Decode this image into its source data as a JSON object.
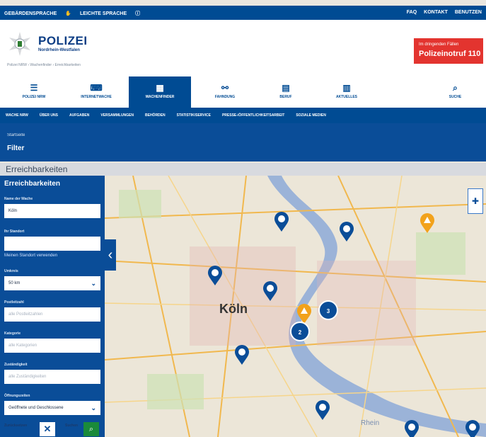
{
  "topbar": {
    "left_items": [
      "GEBÄRDENSPRACHE",
      "LEICHTE SPRACHE"
    ],
    "right_items": [
      "FAQ",
      "KONTAKT",
      "BENUTZEN"
    ]
  },
  "brand": {
    "name": "POLIZEI",
    "state": "Nordrhein-Westfalen"
  },
  "breadcrumb": "Polizei NRW › Wachenfinder › Erreichbarkeiten",
  "emergency": {
    "line1": "Im dringenden Fällen",
    "line2": "Polizeinotruf 110"
  },
  "mainnav": [
    {
      "label": "POLIZEI NRW",
      "icon": "list-icon"
    },
    {
      "label": "INTERNETWACHE",
      "icon": "keyboard-icon"
    },
    {
      "label": "WACHENFINDER",
      "icon": "building-icon"
    },
    {
      "label": "FAHNDUNG",
      "icon": "cuffs-icon"
    },
    {
      "label": "BERUF",
      "icon": "grid-icon"
    },
    {
      "label": "AKTUELLES",
      "icon": "news-icon"
    },
    {
      "label": "SUCHE",
      "icon": "search-icon"
    }
  ],
  "subnav": [
    "WACHE NRW",
    "ÜBER UNS",
    "AUFGABEN",
    "VERSAMMLUNGEN",
    "BEHÖRDEN",
    "STATISTIK/SERVICE",
    "PRESSE-/ÖFFENTLICHKEITSARBEIT",
    "SOZIALE MEDIEN"
  ],
  "pagehead": {
    "small": "Startseite",
    "big": "Filter"
  },
  "section_title": "Erreichbarkeiten",
  "sidebar": {
    "title": "Erreichbarkeiten",
    "name_label": "Name der Wache",
    "name_value": "Köln",
    "location_label": "Ihr Standort",
    "location_value": "",
    "use_location": "Meinen Standort verwenden",
    "radius_label": "Umkreis",
    "radius_value": "50 km",
    "postal_label": "Postleitzahl",
    "postal_placeholder": "alle Postleitzahlen",
    "category_label": "Kategorie",
    "category_placeholder": "alle Kategorien",
    "responsibility_label": "Zuständigkeit",
    "responsibility_placeholder": "alle Zuständigkeiten",
    "hours_label": "Öffnungszeiten",
    "hours_value": "Geöffnete und Geschlossene",
    "reset_label": "Zurücksetzen",
    "search_label": "Suchen"
  },
  "map": {
    "city": "Köln",
    "river": "Rhein",
    "clusters": [
      "3",
      "2"
    ]
  },
  "colors": {
    "primary": "#004b93",
    "emergency": "#e3342f",
    "marker_warning": "#f2a21b",
    "search_button": "#1a8a3a"
  }
}
